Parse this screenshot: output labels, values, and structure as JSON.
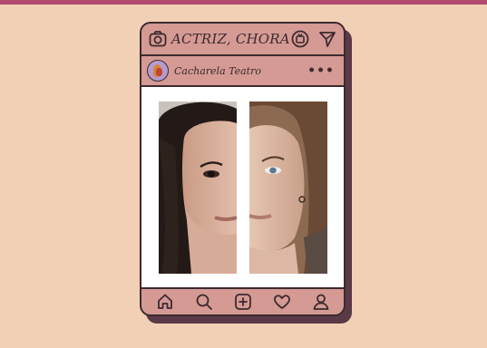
{
  "header": {
    "title": "ACTRIZ, CHORA",
    "icons": [
      "camera-icon",
      "igtv-icon",
      "send-icon"
    ]
  },
  "post": {
    "account_name": "Cacharela Teatro",
    "more_label": "•••",
    "image_description_icons": [
      "photo-left",
      "photo-right"
    ]
  },
  "navbar": {
    "icons": [
      "home-icon",
      "search-icon",
      "add-icon",
      "heart-icon",
      "profile-icon"
    ]
  },
  "colors": {
    "background": "#f2d0b6",
    "card": "#d49a93",
    "outline": "#3c2a30",
    "shadow": "#5a3a46",
    "top_bar": "#b34a6e"
  }
}
